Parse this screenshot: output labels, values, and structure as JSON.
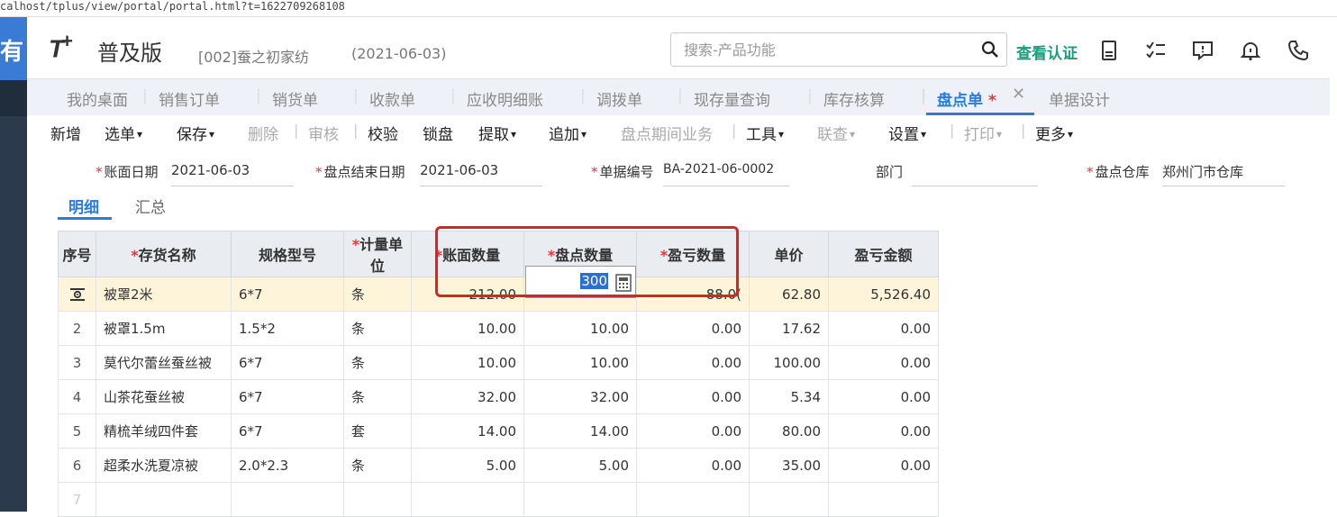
{
  "browser": {
    "url": "calhost/tplus/view/portal/portal.html?t=1622709268108"
  },
  "sidebar": {
    "app_glyph": "有"
  },
  "header": {
    "logo": "T",
    "logo_plus": "+",
    "product": "普及版",
    "company": "[002]蚕之初家纺",
    "date": "(2021-06-03)",
    "search_placeholder": "搜索-产品功能",
    "verify_label": "查看认证",
    "icons": [
      "document-icon",
      "checklist-icon",
      "message-icon",
      "bell-icon",
      "phone-icon"
    ]
  },
  "tabs": [
    {
      "label": "我的桌面"
    },
    {
      "label": "销售订单"
    },
    {
      "label": "销货单"
    },
    {
      "label": "收款单"
    },
    {
      "label": "应收明细账"
    },
    {
      "label": "调拨单"
    },
    {
      "label": "现存量查询"
    },
    {
      "label": "库存核算"
    },
    {
      "label": "盘点单",
      "modified": "*",
      "active": true
    },
    {
      "label": "单据设计"
    }
  ],
  "toolbar": {
    "new": "新增",
    "select": "选单",
    "save": "保存",
    "delete": "删除",
    "audit": "审核",
    "verify": "校验",
    "lock": "锁盘",
    "extract": "提取",
    "append": "追加",
    "period_business": "盘点期间业务",
    "tools": "工具",
    "link_query": "联查",
    "settings": "设置",
    "print": "打印",
    "more": "更多"
  },
  "form": {
    "book_date_label": "账面日期",
    "book_date_value": "2021-06-03",
    "end_date_label": "盘点结束日期",
    "end_date_value": "2021-06-03",
    "doc_no_label": "单据编号",
    "doc_no_value": "BA-2021-06-0002",
    "dept_label": "部门",
    "dept_value": "",
    "warehouse_label": "盘点仓库",
    "warehouse_value": "郑州门市仓库"
  },
  "subtabs": {
    "detail": "明细",
    "summary": "汇总"
  },
  "grid": {
    "columns": [
      "序号",
      "存货名称",
      "规格型号",
      "计量单位",
      "账面数量",
      "盘点数量",
      "盈亏数量",
      "单价",
      "盈亏金额"
    ],
    "required": [
      false,
      true,
      false,
      true,
      true,
      true,
      true,
      false,
      false
    ],
    "rows": [
      {
        "idx": "",
        "name": "被罩2米",
        "spec": "6*7",
        "unit": "条",
        "book_qty": "212.00",
        "count_qty": "300",
        "diff_qty": "88.0(",
        "price": "62.80",
        "amount": "5,526.40"
      },
      {
        "idx": "2",
        "name": "被罩1.5m",
        "spec": "1.5*2",
        "unit": "条",
        "book_qty": "10.00",
        "count_qty": "10.00",
        "diff_qty": "0.00",
        "price": "17.62",
        "amount": "0.00"
      },
      {
        "idx": "3",
        "name": "莫代尔蕾丝蚕丝被",
        "spec": "6*7",
        "unit": "条",
        "book_qty": "10.00",
        "count_qty": "10.00",
        "diff_qty": "0.00",
        "price": "100.00",
        "amount": "0.00"
      },
      {
        "idx": "4",
        "name": "山茶花蚕丝被",
        "spec": "6*7",
        "unit": "条",
        "book_qty": "32.00",
        "count_qty": "32.00",
        "diff_qty": "0.00",
        "price": "5.34",
        "amount": "0.00"
      },
      {
        "idx": "5",
        "name": "精梳羊绒四件套",
        "spec": "6*7",
        "unit": "套",
        "book_qty": "14.00",
        "count_qty": "14.00",
        "diff_qty": "0.00",
        "price": "80.00",
        "amount": "0.00"
      },
      {
        "idx": "6",
        "name": "超柔水洗夏凉被",
        "spec": "2.0*2.3",
        "unit": "条",
        "book_qty": "5.00",
        "count_qty": "5.00",
        "diff_qty": "0.00",
        "price": "35.00",
        "amount": "0.00"
      },
      {
        "idx": "7",
        "name": "",
        "spec": "",
        "unit": "",
        "book_qty": "",
        "count_qty": "",
        "diff_qty": "",
        "price": "",
        "amount": ""
      }
    ]
  },
  "colors": {
    "accent": "#2a7ae2",
    "verify": "#1a9d7d",
    "highlight": "#e41f1f",
    "required": "#e33"
  }
}
